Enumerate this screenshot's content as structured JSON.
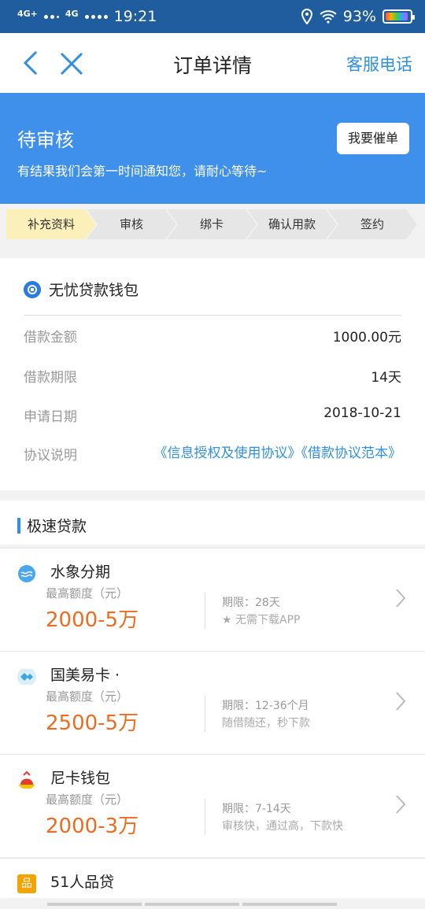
{
  "status_bar": {
    "network1": "4G+",
    "network2": "4G",
    "time": "19:21",
    "battery_percent": "93%",
    "battery_level": 0.93
  },
  "nav": {
    "title": "订单详情",
    "service_link": "客服电话"
  },
  "banner": {
    "status": "待审核",
    "hint": "有结果我们会第一时间通知您，请耐心等待~",
    "urge_button": "我要催单",
    "color": "#3f90ea"
  },
  "steps": [
    {
      "label": "补充资料",
      "active": true
    },
    {
      "label": "审核",
      "active": false
    },
    {
      "label": "绑卡",
      "active": false
    },
    {
      "label": "确认用款",
      "active": false
    },
    {
      "label": "签约",
      "active": false
    }
  ],
  "product": {
    "name": "无忧贷款钱包",
    "rows": [
      {
        "key": "借款金额",
        "value": "1000.00元"
      },
      {
        "key": "借款期限",
        "value": "14天"
      },
      {
        "key": "申请日期",
        "value": "2018-10-21"
      }
    ],
    "agreement_key": "协议说明",
    "agreement_links": "《信息授权及使用协议》《借款协议范本》"
  },
  "section": {
    "title": "极速贷款"
  },
  "loans": [
    {
      "name": "水象分期",
      "cap_label": "最高额度（元）",
      "amount": "2000-5万",
      "term": "期限：28天",
      "note": "★ 无需下载APP",
      "icon": "water-drop-icon"
    },
    {
      "name": "国美易卡 ·",
      "cap_label": "最高额度（元）",
      "amount": "2500-5万",
      "term": "期限：12-36个月",
      "note": "随借随还，秒下款",
      "icon": "card-icon"
    },
    {
      "name": "尼卡钱包",
      "cap_label": "最高额度（元）",
      "amount": "2000-3万",
      "term": "期限：7-14天",
      "note": "审核快，通过高，下款快",
      "icon": "red-bag-icon"
    },
    {
      "name": "51人品贷",
      "icon": "pin-logo-icon",
      "icon_text": "品"
    }
  ],
  "colors": {
    "accent": "#2f8fe0",
    "amount": "#ef6b1f"
  }
}
